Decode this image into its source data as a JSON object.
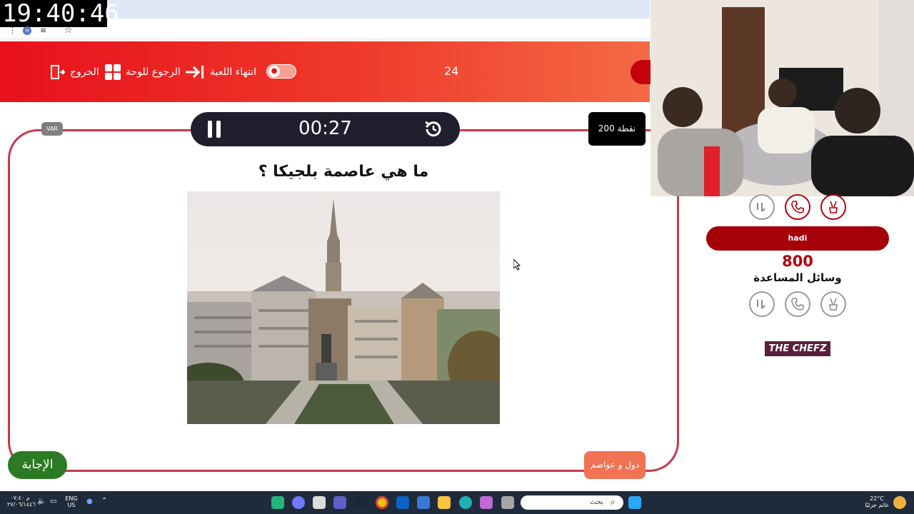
{
  "overlay": {
    "clock": "19:40:46"
  },
  "browser": {
    "star_glyph": "☆",
    "profile_letter": "H"
  },
  "header": {
    "exit_label": "الخروج",
    "board_label": "الرجوع للوحة",
    "end_game_label": "انتهاء اللعبة",
    "round_number": "24"
  },
  "game": {
    "timer": "00:27",
    "points_badge": "200 نقطة",
    "var_label": "VAR",
    "question": "ما هي عاصمة بلجيكا ؟",
    "answer_button": "الإجابة",
    "category_button": "دول و عواصم"
  },
  "team": {
    "name": "hadi",
    "score": "800",
    "aids_label": "وسائل المساعدة",
    "sponsor": "THE CHEFZ"
  },
  "taskbar": {
    "search_placeholder": "بحث",
    "lang_top": "ENG",
    "lang_bottom": "US",
    "time": "م ٠٧:٤٠",
    "date": "٢٧/٠٦/١٤٤٦",
    "weather_temp": "22°C",
    "weather_text": "غائم جزئيًا"
  },
  "colors": {
    "header_red": "#e8101c",
    "frame_red": "#c43a4c",
    "answer_green": "#2c7a24",
    "category_orange": "#f07454",
    "team_red": "#a60008"
  },
  "icons": [
    "pause-icon",
    "reset-icon",
    "exit-icon",
    "board-grid-icon",
    "end-game-icon",
    "phone-icon",
    "two-answers-icon",
    "peace-hand-icon",
    "windows-start-icon"
  ]
}
